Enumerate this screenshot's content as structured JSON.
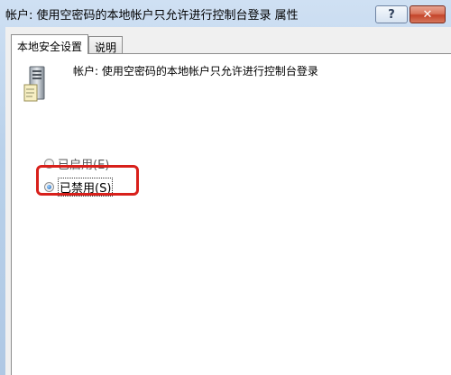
{
  "window": {
    "title": "帐户: 使用空密码的本地帐户只允许进行控制台登录 属性",
    "help_label": "?",
    "close_label": "✕"
  },
  "tabs": [
    {
      "label": "本地安全设置",
      "active": true
    },
    {
      "label": "说明",
      "active": false
    }
  ],
  "policy": {
    "icon": "server-icon",
    "name": "帐户: 使用空密码的本地帐户只允许进行控制台登录"
  },
  "options": {
    "enabled_label": "已启用(E)",
    "disabled_label": "已禁用(S)",
    "selected": "disabled"
  },
  "colors": {
    "highlight": "#d8201b",
    "close_button": "#c4442a"
  }
}
